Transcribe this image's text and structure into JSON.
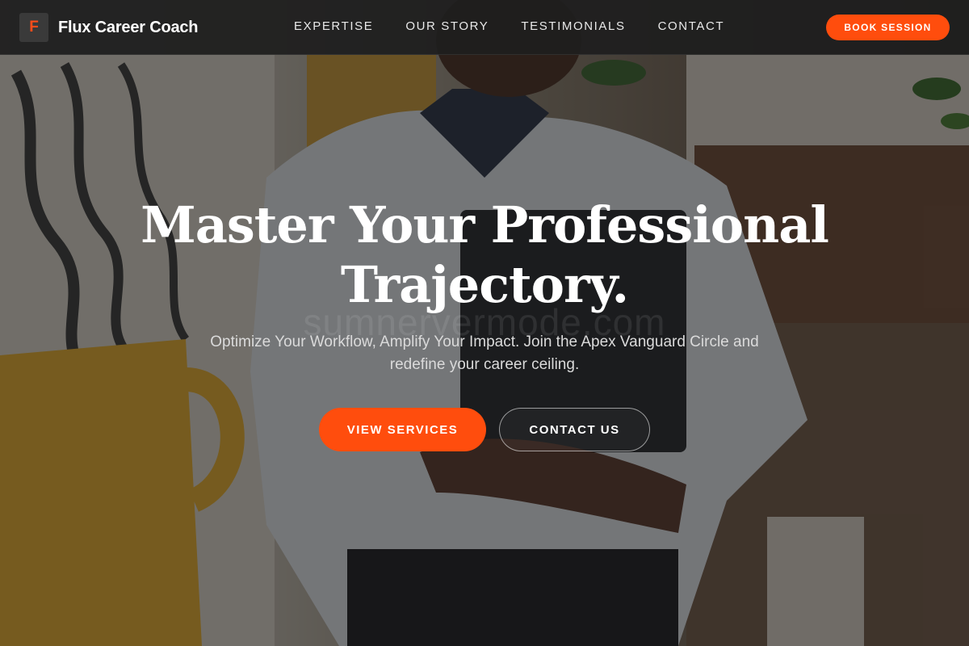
{
  "brand": {
    "mark": "F",
    "name": "Flux Career Coach"
  },
  "nav": {
    "items": [
      {
        "label": "EXPERTISE"
      },
      {
        "label": "OUR STORY"
      },
      {
        "label": "TESTIMONIALS"
      },
      {
        "label": "CONTACT"
      }
    ],
    "cta_label": "BOOK SESSION"
  },
  "hero": {
    "title_line1": "Master Your Professional",
    "title_line2": "Trajectory.",
    "watermark": "sumnervermode.com",
    "subtitle": "Optimize Your Workflow, Amplify Your Impact. Join the Apex Vanguard Circle and redefine your career ceiling.",
    "primary_cta": "VIEW SERVICES",
    "secondary_cta": "CONTACT US",
    "background_image": "professional-woman-holding-laptop-photo"
  },
  "colors": {
    "accent": "#ff4d0d",
    "navbar": "#1e1e1e",
    "text": "#ffffff"
  }
}
